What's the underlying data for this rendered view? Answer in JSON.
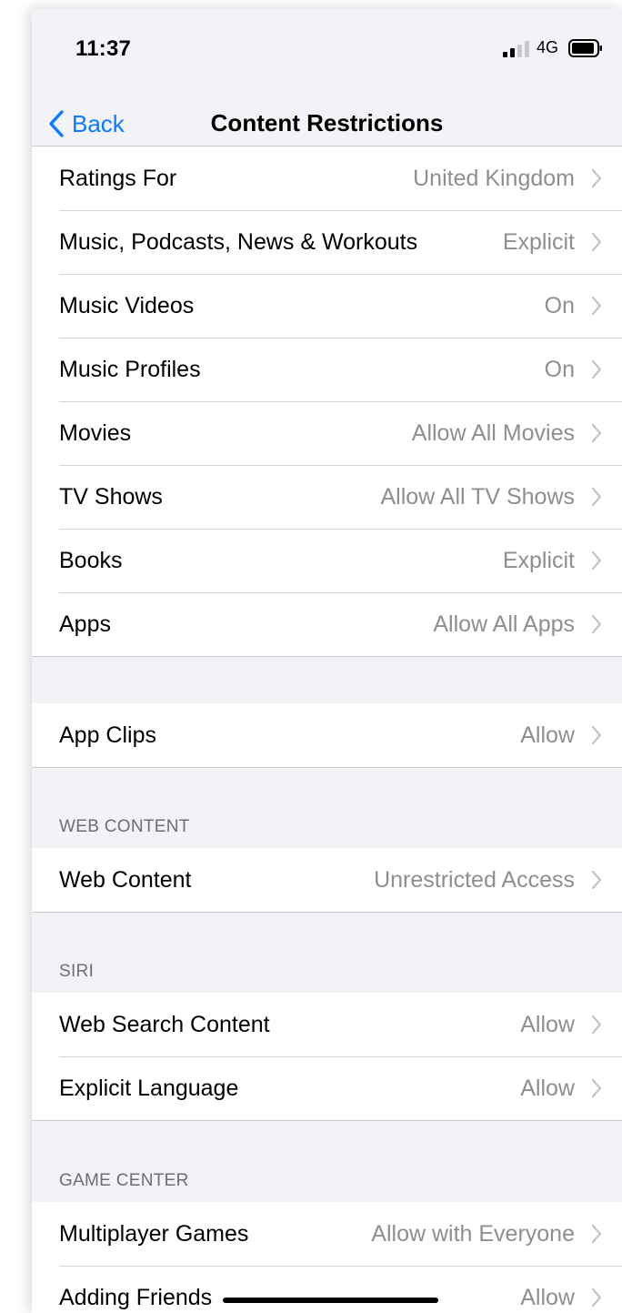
{
  "status_bar": {
    "time": "11:37",
    "network": "4G"
  },
  "nav": {
    "back_label": "Back",
    "title": "Content Restrictions"
  },
  "group1": [
    {
      "label": "Ratings For",
      "value": "United Kingdom"
    },
    {
      "label": "Music, Podcasts, News & Workouts",
      "value": "Explicit"
    },
    {
      "label": "Music Videos",
      "value": "On"
    },
    {
      "label": "Music Profiles",
      "value": "On"
    },
    {
      "label": "Movies",
      "value": "Allow All Movies"
    },
    {
      "label": "TV Shows",
      "value": "Allow All TV Shows"
    },
    {
      "label": "Books",
      "value": "Explicit"
    },
    {
      "label": "Apps",
      "value": "Allow All Apps"
    }
  ],
  "group2": [
    {
      "label": "App Clips",
      "value": "Allow"
    }
  ],
  "web_content": {
    "header": "WEB CONTENT",
    "rows": [
      {
        "label": "Web Content",
        "value": "Unrestricted Access"
      }
    ]
  },
  "siri": {
    "header": "SIRI",
    "rows": [
      {
        "label": "Web Search Content",
        "value": "Allow"
      },
      {
        "label": "Explicit Language",
        "value": "Allow"
      }
    ]
  },
  "game_center": {
    "header": "GAME CENTER",
    "rows": [
      {
        "label": "Multiplayer Games",
        "value": "Allow with Everyone"
      },
      {
        "label": "Adding Friends",
        "value": "Allow"
      }
    ]
  },
  "colors": {
    "accent": "#0a7aff",
    "background": "#f2f2f7",
    "secondary_text": "#8e8e93"
  }
}
